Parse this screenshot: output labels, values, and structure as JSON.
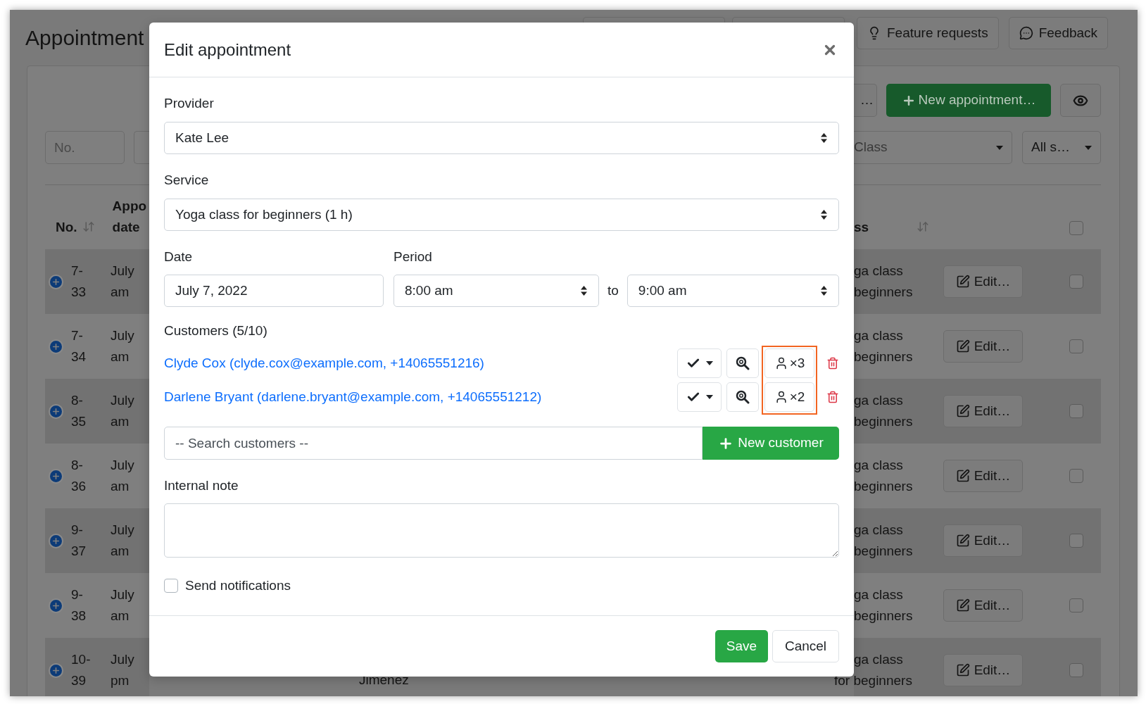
{
  "page": {
    "title": "Appointment",
    "header_buttons": [
      {
        "label": "Feature requests",
        "kind": "bulb"
      },
      {
        "label": "Feedback",
        "kind": "chat"
      }
    ],
    "toolbar": {
      "cut_button": "…",
      "new_button": "New appointment…"
    },
    "filters": {
      "number_placeholder": "No.",
      "class_value": "Class",
      "status_value": "All s…"
    },
    "table": {
      "columns": {
        "number": "No.",
        "date": [
          "Appo",
          "date"
        ],
        "class": "ss"
      },
      "select_all_checked": false,
      "rows": [
        {
          "number": [
            "7-",
            "33"
          ],
          "date": [
            "July",
            "am"
          ],
          "class": [
            "ga class",
            "beginners"
          ],
          "edit": "Edit…",
          "checked": false
        },
        {
          "number": [
            "7-",
            "34"
          ],
          "date": [
            "July",
            "am"
          ],
          "class": [
            "ga class",
            "beginners"
          ],
          "edit": "Edit…",
          "checked": false
        },
        {
          "number": [
            "8-",
            "35"
          ],
          "date": [
            "July",
            "am"
          ],
          "class": [
            "ga class",
            "beginners"
          ],
          "edit": "Edit…",
          "checked": false
        },
        {
          "number": [
            "8-",
            "36"
          ],
          "date": [
            "July",
            "am"
          ],
          "class": [
            "ga class",
            "beginners"
          ],
          "edit": "Edit…",
          "checked": false
        },
        {
          "number": [
            "9-",
            "37"
          ],
          "date": [
            "July",
            "am"
          ],
          "class": [
            "ga class",
            "beginners"
          ],
          "edit": "Edit…",
          "checked": false
        },
        {
          "number": [
            "9-",
            "38"
          ],
          "date": [
            "July",
            "am"
          ],
          "class": [
            "ga class",
            "beginners"
          ],
          "edit": "Edit…",
          "checked": false
        },
        {
          "number": [
            "10-",
            "39"
          ],
          "date": [
            "July",
            "pm"
          ],
          "customer": "Jimenez",
          "class": [
            "ga class",
            "for beginners"
          ],
          "edit": "Edit…",
          "checked": false
        }
      ]
    }
  },
  "modal": {
    "title": "Edit appointment",
    "provider": {
      "label": "Provider",
      "value": "Kate Lee"
    },
    "service": {
      "label": "Service",
      "value": "Yoga class for beginners (1 h)"
    },
    "date": {
      "label": "Date",
      "value": "July 7, 2022"
    },
    "period": {
      "label": "Period",
      "start": "8:00 am",
      "separator": "to",
      "end": "9:00 am"
    },
    "customers": {
      "label": "Customers (5/10)",
      "counts_highlighted": true,
      "items": [
        {
          "text": "Clyde Cox (clyde.cox@example.com, +14065551216)",
          "count": "×3"
        },
        {
          "text": "Darlene Bryant (darlene.bryant@example.com, +14065551212)",
          "count": "×2"
        }
      ]
    },
    "search": {
      "placeholder": "-- Search customers --",
      "button": "New customer"
    },
    "note": {
      "label": "Internal note"
    },
    "notifications": {
      "label": "Send notifications",
      "checked": false
    },
    "buttons": {
      "save": "Save",
      "cancel": "Cancel"
    }
  }
}
